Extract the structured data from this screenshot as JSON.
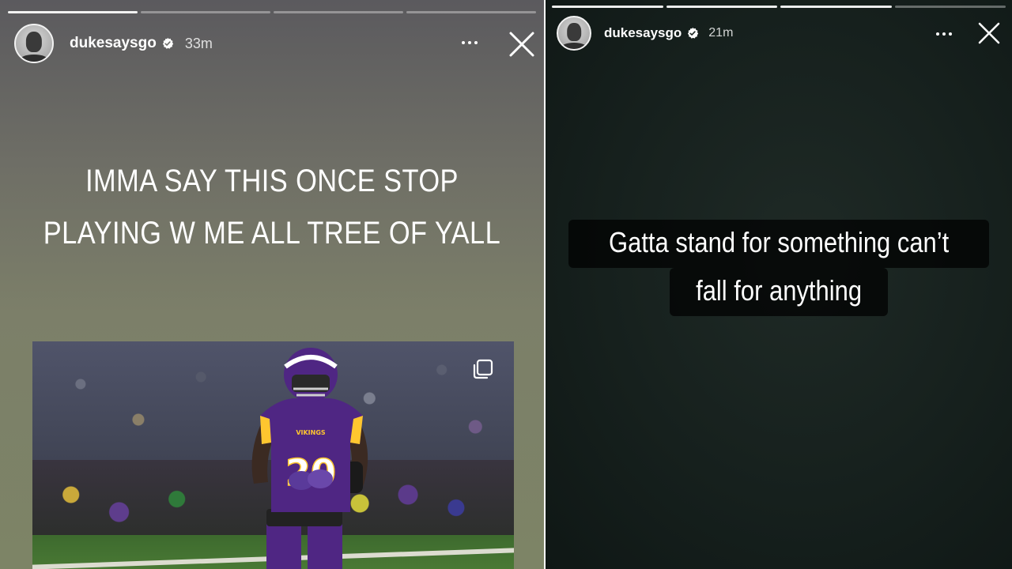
{
  "left_story": {
    "progress_segments": 4,
    "progress_completed": 1,
    "username": "dukesaysgo",
    "time": "33m",
    "headline_lines": [
      "IMMA SAY THIS ONCE STOP",
      "PLAYING W ME ALL TREE OF YALL"
    ],
    "jersey_number": "20",
    "team_wordmark": "VIKINGS"
  },
  "right_story": {
    "progress_segments": 4,
    "progress_completed": 3,
    "username": "dukesaysgo",
    "time": "21m",
    "caption_lines": [
      "Gatta stand for something can’t",
      "fall for anything"
    ]
  },
  "colors": {
    "vikings_purple": "#4f2683",
    "vikings_gold": "#ffc62f",
    "verified_icon": "#ffffff"
  },
  "icons": {
    "more": "more-horizontal-icon",
    "close": "close-x-icon",
    "verified": "verified-badge-icon",
    "multi_photo": "multi-photo-icon"
  }
}
